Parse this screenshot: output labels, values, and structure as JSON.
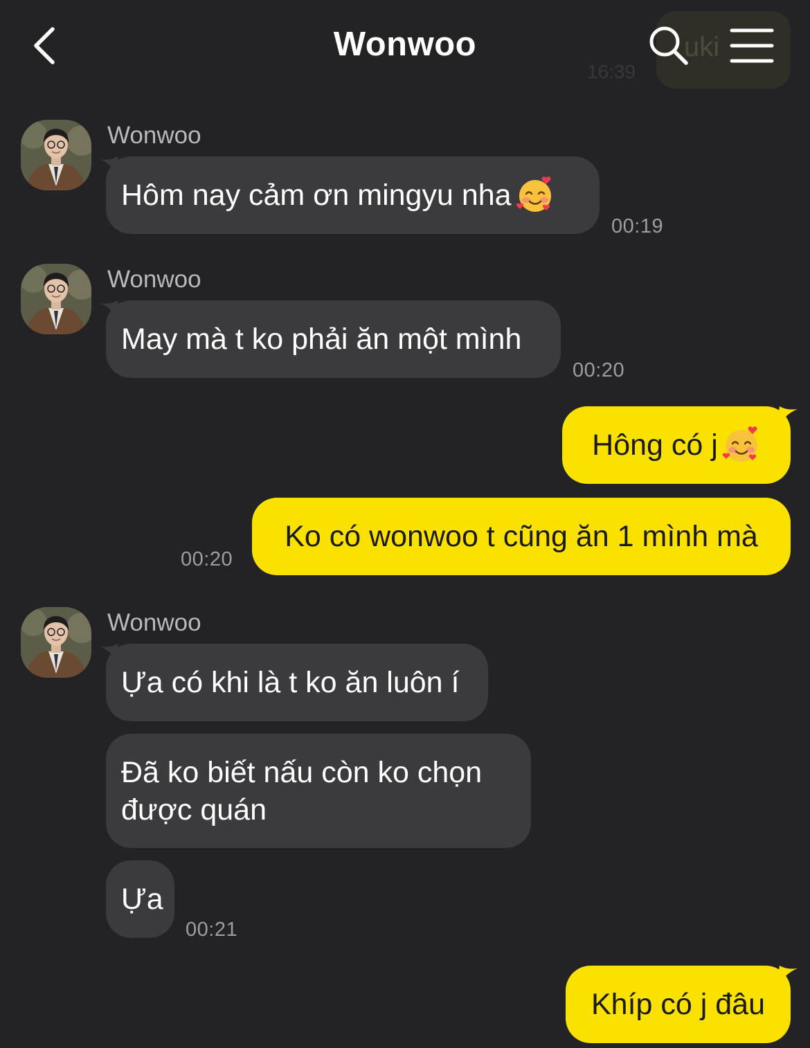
{
  "header": {
    "title": "Wonwoo",
    "icons": {
      "back": "chevron-left-icon",
      "search": "search-icon",
      "menu": "hamburger-menu-icon"
    }
  },
  "ghost": {
    "text": "uki",
    "time": "16:39"
  },
  "colors": {
    "background": "#232325",
    "incoming_bubble": "#3b3b3e",
    "outgoing_bubble": "#fae100",
    "time": "#9e9ea2",
    "sender": "#b9b9bc"
  },
  "messages": [
    {
      "from": "Wonwoo",
      "text": "Hôm nay cảm ơn mingyu nha",
      "emoji": "smiling-face-with-hearts",
      "time": "00:19"
    },
    {
      "from": "Wonwoo",
      "text": "May mà t ko phải ăn một mình",
      "time": "00:20"
    },
    {
      "from": "me",
      "text": "Hông có j",
      "emoji": "smiling-face-with-hearts"
    },
    {
      "from": "me",
      "text": "Ko có wonwoo t cũng ăn 1 mình mà",
      "time": "00:20"
    },
    {
      "from": "Wonwoo",
      "text": "Ựa có khi là t ko ăn luôn í"
    },
    {
      "from": "Wonwoo",
      "text_line1": "Đã ko biết nấu còn ko chọn",
      "text_line2": "được quán"
    },
    {
      "from": "Wonwoo",
      "text": "Ựa",
      "time": "00:21"
    },
    {
      "from": "me",
      "text": "Khíp có j đâu"
    }
  ]
}
